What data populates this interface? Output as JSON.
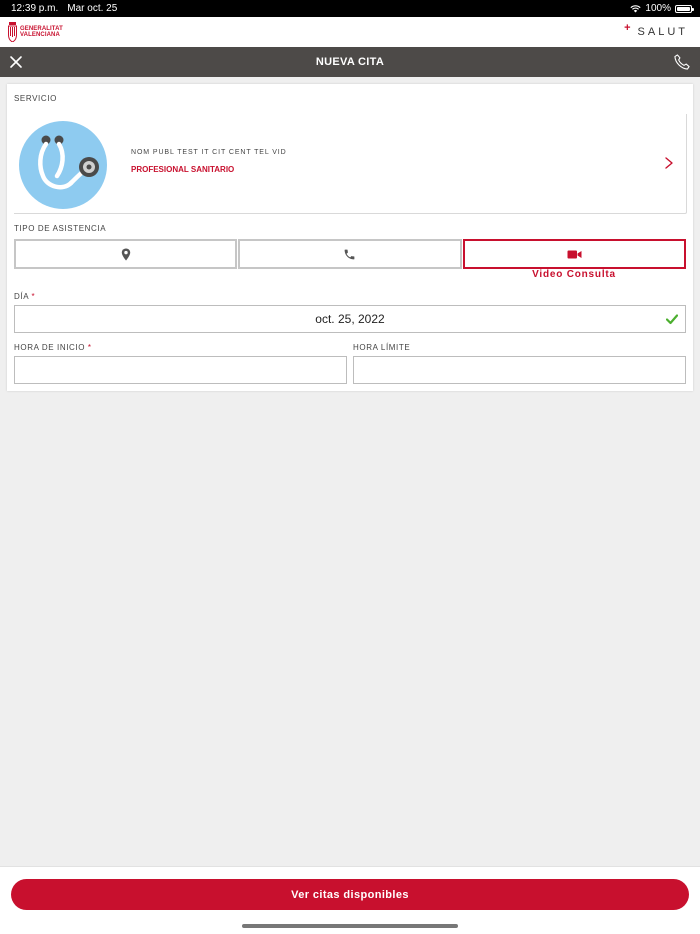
{
  "status_bar": {
    "time": "12:39 p.m.",
    "date": "Mar oct. 25",
    "battery_percent": "100%",
    "battery_level": 1.0
  },
  "brand": {
    "org_line1": "GENERALITAT",
    "org_line2": "VALENCIANA",
    "app_plus": "+",
    "app_name": "SALUT",
    "accent_color": "#c8102e"
  },
  "nav": {
    "title": "NUEVA CITA",
    "left_icon": "close-icon",
    "right_icon": "phone-icon"
  },
  "form": {
    "service_label": "SERVICIO",
    "service": {
      "name": "NOM PUBL TEST IT CIT CENT TEL VID",
      "type": "PROFESIONAL SANITARIO",
      "icon": "stethoscope-icon"
    },
    "assistance_label": "TIPO DE ASISTENCIA",
    "assistance_types": [
      {
        "icon": "location-pin-icon",
        "selected": false
      },
      {
        "icon": "phone-icon",
        "selected": false
      },
      {
        "icon": "video-camera-icon",
        "selected": true,
        "caption": "Video Consulta"
      }
    ],
    "day_label": "DÍA",
    "required_mark": "*",
    "day_value": "oct. 25, 2022",
    "day_valid_icon": "checkmark-icon",
    "start_label": "HORA DE INICIO",
    "start_value": "",
    "end_label": "HORA LÍMITE",
    "end_value": ""
  },
  "footer": {
    "button_label": "Ver citas disponibles"
  }
}
